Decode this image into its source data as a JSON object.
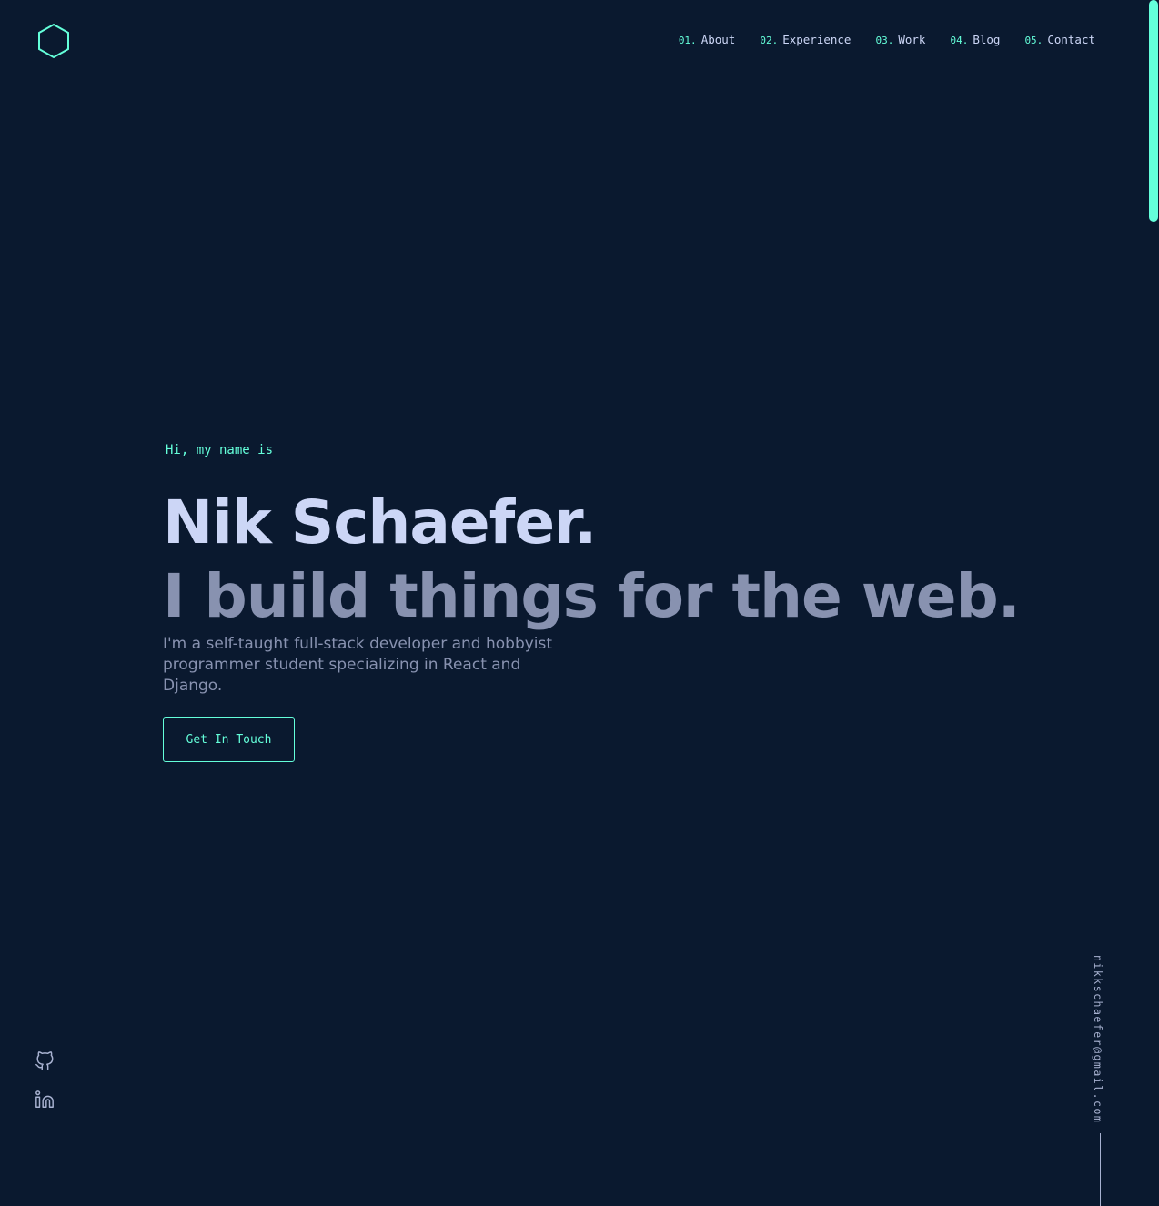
{
  "header": {
    "logo_icon": "hexagon-logo-icon",
    "nav": [
      {
        "num": "01.",
        "label": "About"
      },
      {
        "num": "02.",
        "label": "Experience"
      },
      {
        "num": "03.",
        "label": "Work"
      },
      {
        "num": "04.",
        "label": "Blog"
      },
      {
        "num": "05.",
        "label": "Contact"
      }
    ]
  },
  "hero": {
    "greeting": "Hi, my name is",
    "name": "Nik Schaefer.",
    "tagline": "I build things for the web.",
    "intro": "I'm a self-taught full-stack developer and hobbyist programmer student specializing in React and Django.",
    "cta_label": "Get In Touch"
  },
  "social": {
    "github_icon": "github-icon",
    "linkedin_icon": "linkedin-icon"
  },
  "email": "nikkschaefer@gmail.com",
  "colors": {
    "background": "#0a192f",
    "accent": "#64ffda",
    "heading": "#ccd6f6",
    "text": "#8892b0"
  }
}
